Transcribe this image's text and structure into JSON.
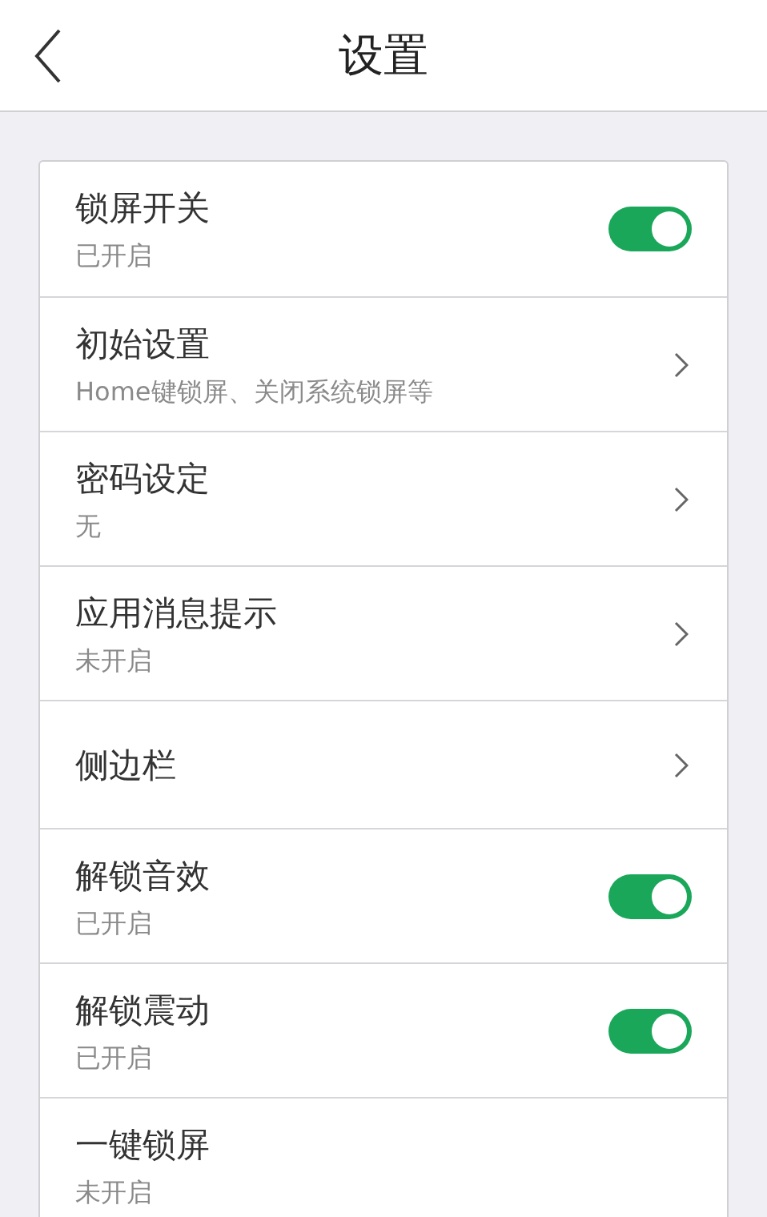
{
  "header": {
    "title": "设置"
  },
  "settings": [
    {
      "kind": "toggle",
      "title": "锁屏开关",
      "subtitle": "已开启",
      "on": true
    },
    {
      "kind": "link",
      "title": "初始设置",
      "subtitle": "Home键锁屏、关闭系统锁屏等"
    },
    {
      "kind": "link",
      "title": "密码设定",
      "subtitle": "无"
    },
    {
      "kind": "link",
      "title": "应用消息提示",
      "subtitle": "未开启"
    },
    {
      "kind": "link",
      "title": "侧边栏"
    },
    {
      "kind": "toggle",
      "title": "解锁音效",
      "subtitle": "已开启",
      "on": true
    },
    {
      "kind": "toggle",
      "title": "解锁震动",
      "subtitle": "已开启",
      "on": true
    },
    {
      "kind": "plain",
      "title": "一键锁屏",
      "subtitle": "未开启"
    }
  ]
}
